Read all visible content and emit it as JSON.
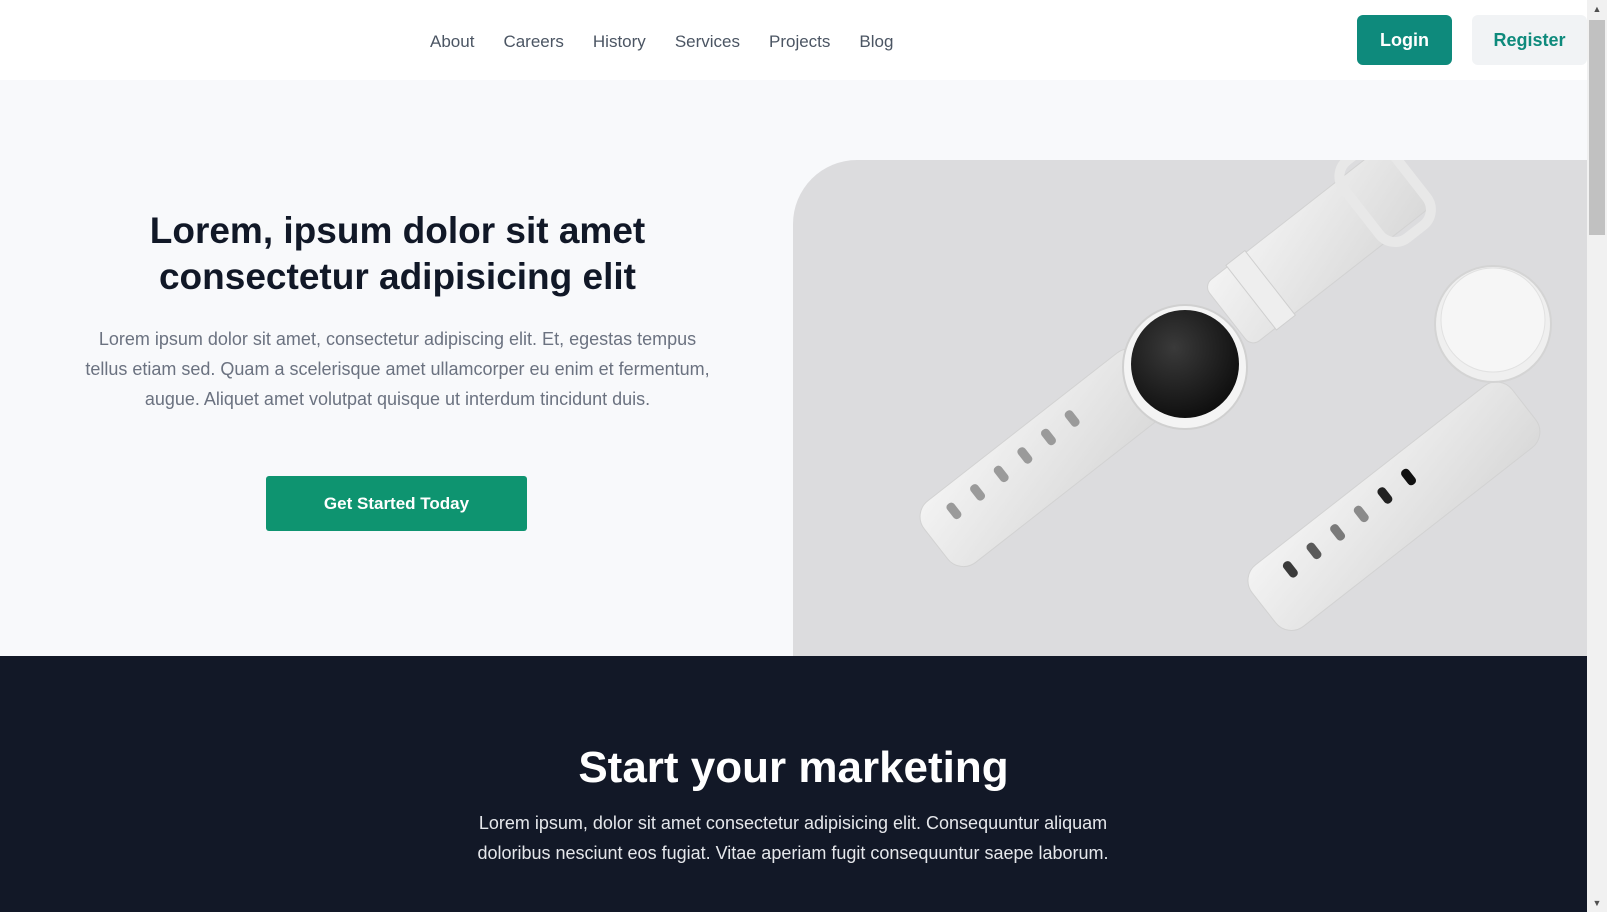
{
  "nav": {
    "items": [
      "About",
      "Careers",
      "History",
      "Services",
      "Projects",
      "Blog"
    ],
    "login_label": "Login",
    "register_label": "Register"
  },
  "hero": {
    "title": "Lorem, ipsum dolor sit amet consectetur adipisicing elit",
    "subtitle": "Lorem ipsum dolor sit amet, consectetur adipiscing elit. Et, egestas tempus tellus etiam sed. Quam a scelerisque amet ullamcorper eu enim et fermentum, augue. Aliquet amet volutpat quisque ut interdum tincidunt duis.",
    "cta_label": "Get Started Today",
    "image_icon": "smartwatch-image"
  },
  "marketing": {
    "title": "Start your marketing",
    "subtitle": "Lorem ipsum, dolor sit amet consectetur adipisicing elit. Consequuntur aliquam doloribus nesciunt eos fugiat. Vitae aperiam fugit consequuntur saepe laborum."
  },
  "colors": {
    "accent": "#0e8a7c",
    "cta": "#0e9470",
    "dark_section": "#121827"
  },
  "scrollbar": {
    "up_icon": "scroll-up-arrow-icon",
    "down_icon": "scroll-down-arrow-icon"
  }
}
